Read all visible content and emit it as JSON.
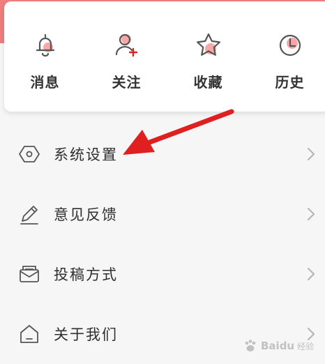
{
  "colors": {
    "accent": "#f07e7e",
    "icon_gray": "#555555",
    "accent_dot": "#f48a8a",
    "annotation_red": "#e02020",
    "chevron": "#b3b3b3",
    "text": "#333333",
    "page_bg": "#f6f6f6",
    "card_bg": "#ffffff"
  },
  "quick_actions": [
    {
      "label": "消息",
      "icon": "bell-icon"
    },
    {
      "label": "关注",
      "icon": "user-add-icon"
    },
    {
      "label": "收藏",
      "icon": "star-icon"
    },
    {
      "label": "历史",
      "icon": "clock-icon"
    }
  ],
  "menu": [
    {
      "label": "系统设置",
      "icon": "settings-icon"
    },
    {
      "label": "意见反馈",
      "icon": "pencil-icon"
    },
    {
      "label": "投稿方式",
      "icon": "mail-icon"
    },
    {
      "label": "关于我们",
      "icon": "home-icon"
    }
  ],
  "watermark": {
    "brand": "Baidu",
    "sub": "经验",
    "icon": "paw-icon"
  }
}
